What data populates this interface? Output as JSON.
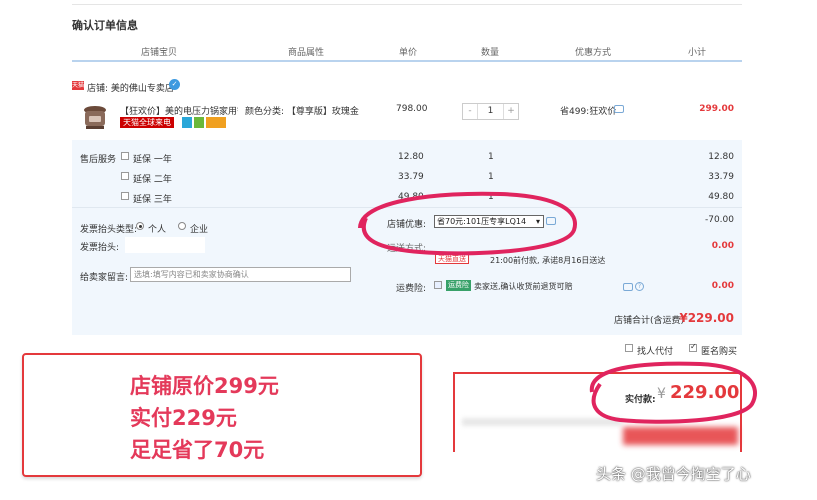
{
  "page": {
    "title": "确认订单信息"
  },
  "columns": [
    "店铺宝贝",
    "商品属性",
    "单价",
    "数量",
    "优惠方式",
    "小计"
  ],
  "shop": {
    "tag": "天猫",
    "name": "店铺: 美的佛山专卖店"
  },
  "item": {
    "title": "【狂欢价】美的电压力锅家用智...",
    "global_badge": "天猫全球来电",
    "attr": "颜色分类: 【尊享版】玫瑰金",
    "price": "798.00",
    "qty": "1",
    "qty_minus": "-",
    "qty_plus": "+",
    "promo": "省499:狂欢价",
    "subtotal": "299.00"
  },
  "after_sales": {
    "label": "售后服务",
    "options": [
      {
        "label": "延保 一年",
        "price": "12.80",
        "qty": "1",
        "subtotal": "12.80"
      },
      {
        "label": "延保 二年",
        "price": "33.79",
        "qty": "1",
        "subtotal": "33.79"
      },
      {
        "label": "延保 三年",
        "price": "49.80",
        "qty": "1",
        "subtotal": "49.80"
      }
    ]
  },
  "invoice": {
    "type_label": "发票抬头类型:",
    "personal": "个人",
    "company": "企业",
    "title_label": "发票抬头:",
    "message_label": "给卖家留言:",
    "message_placeholder": "选填:填写内容已和卖家协商确认"
  },
  "discount": {
    "label": "店铺优惠:",
    "selected": "省70元:101压专享LQ14",
    "value": "-70.00"
  },
  "shipping": {
    "label": "运送方式:",
    "badge": "天猫直送",
    "text": "21:00前付款, 承诺8月16日送达",
    "value": "0.00"
  },
  "insurance": {
    "label": "运费险:",
    "badge": "运费险",
    "text": "卖家送,确认收货前退货可赔",
    "value": "0.00"
  },
  "shop_total": {
    "label": "店铺合计(含运费)",
    "value": "¥229.00"
  },
  "options": {
    "proxy_pay": "找人代付",
    "anonymous": "匿名购买"
  },
  "payment": {
    "label": "实付款:",
    "currency": "¥",
    "value": "229.00"
  },
  "annotation": {
    "lines": [
      "店铺原价299元",
      "实付229元",
      "足足省了70元"
    ]
  },
  "watermark": "头条 @我曾今掏空了心",
  "colors": {
    "accent_red": "#e4393c",
    "panel_blue": "#f1f7fd",
    "circle_magenta": "#e0245e"
  }
}
